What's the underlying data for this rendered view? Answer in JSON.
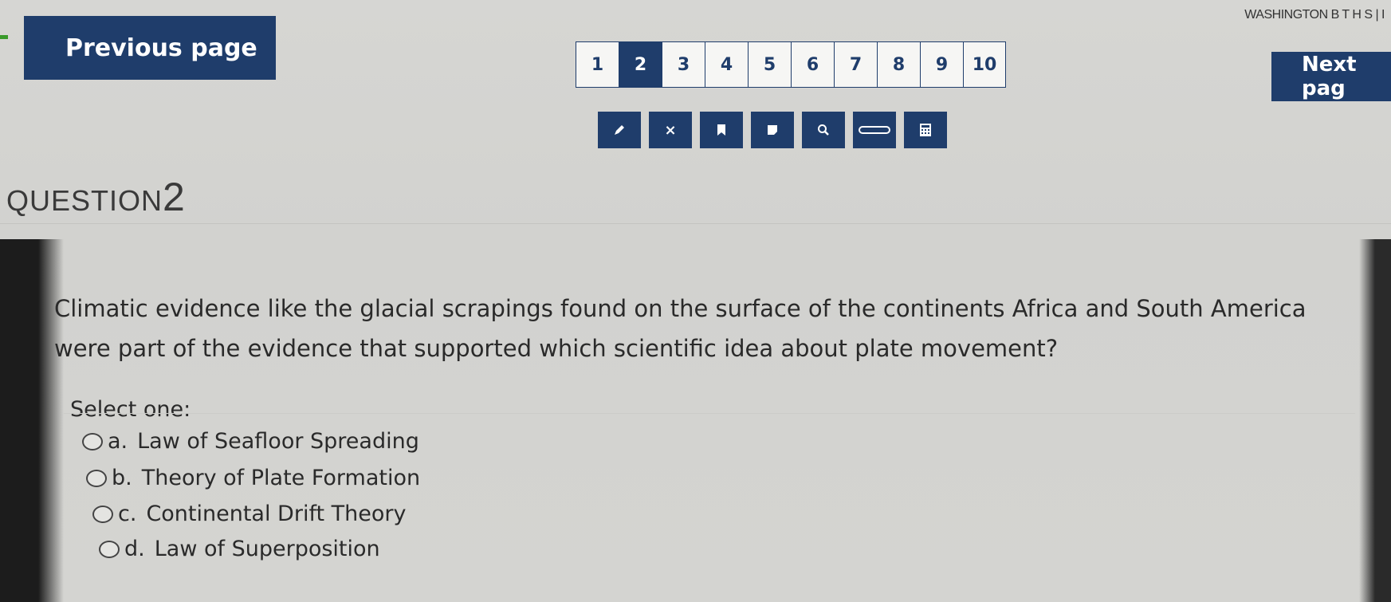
{
  "header": {
    "school_name": "WASHINGTON B T H S | I",
    "previous_label": "Previous page",
    "next_label": "Next pag"
  },
  "pagination": {
    "pages": [
      "1",
      "2",
      "3",
      "4",
      "5",
      "6",
      "7",
      "8",
      "9",
      "10"
    ],
    "current": "2"
  },
  "toolbar": {
    "tools": [
      "pencil-icon",
      "close-icon",
      "bookmark-icon",
      "highlighter-icon",
      "zoom-icon",
      "line-reader-icon",
      "calculator-icon"
    ],
    "close_glyph": "×"
  },
  "question": {
    "label": "QUESTION",
    "number": "2",
    "text_line1": "Climatic evidence like the glacial scrapings found on the surface of the continents Africa and South America",
    "text_line2": "were part of the evidence that supported which scientific idea about plate movement?",
    "select_label": "Select one:",
    "options": [
      {
        "letter": "a.",
        "text": "Law of Seafloor Spreading"
      },
      {
        "letter": "b.",
        "text": "Theory of Plate Formation"
      },
      {
        "letter": "c.",
        "text": "Continental Drift Theory"
      },
      {
        "letter": "d.",
        "text": "Law of Superposition"
      }
    ]
  },
  "colors": {
    "accent": "#1f3d6b",
    "background": "#d4d4d1"
  }
}
